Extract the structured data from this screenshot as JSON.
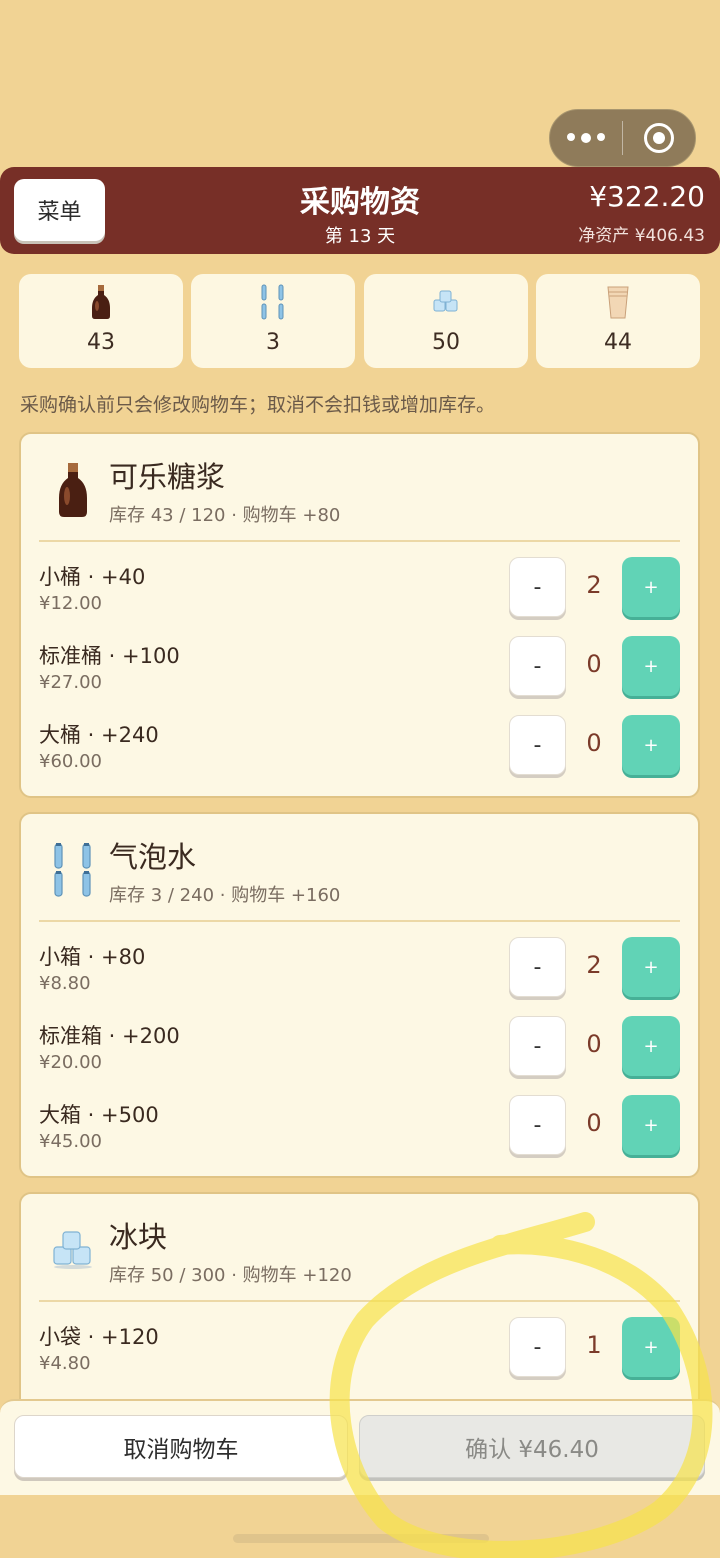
{
  "header": {
    "menu_label": "菜单",
    "title": "采购物资",
    "day": "第 13 天",
    "money": "¥322.20",
    "net_assets": "净资产 ¥406.43"
  },
  "inventory": [
    {
      "icon": "syrup-bottle-icon",
      "count": "43"
    },
    {
      "icon": "soda-bottles-icon",
      "count": "3"
    },
    {
      "icon": "ice-cubes-icon",
      "count": "50"
    },
    {
      "icon": "paper-cups-icon",
      "count": "44"
    }
  ],
  "notice": "采购确认前只会修改购物车；取消不会扣钱或增加库存。",
  "cards": [
    {
      "name": "可乐糖浆",
      "stock": "库存 43 / 120 · 购物车 +80",
      "rows": [
        {
          "name": "小桶 · +40",
          "price": "¥12.00",
          "qty": "2"
        },
        {
          "name": "标准桶 · +100",
          "price": "¥27.00",
          "qty": "0"
        },
        {
          "name": "大桶 · +240",
          "price": "¥60.00",
          "qty": "0"
        }
      ]
    },
    {
      "name": "气泡水",
      "stock": "库存 3 / 240 · 购物车 +160",
      "rows": [
        {
          "name": "小箱 · +80",
          "price": "¥8.80",
          "qty": "2"
        },
        {
          "name": "标准箱 · +200",
          "price": "¥20.00",
          "qty": "0"
        },
        {
          "name": "大箱 · +500",
          "price": "¥45.00",
          "qty": "0"
        }
      ]
    },
    {
      "name": "冰块",
      "stock": "库存 50 / 300 · 购物车 +120",
      "rows": [
        {
          "name": "小袋 · +120",
          "price": "¥4.80",
          "qty": "1"
        }
      ]
    }
  ],
  "buttons": {
    "minus": "-",
    "plus": "+",
    "cancel": "取消购物车",
    "confirm": "确认 ¥46.40"
  },
  "colors": {
    "background": "#f1d394",
    "header": "#772f27",
    "plus_button": "#61d3b6",
    "highlight": "#f7e24a"
  }
}
